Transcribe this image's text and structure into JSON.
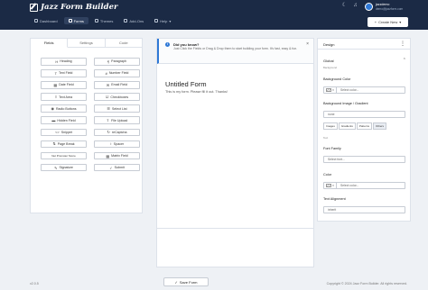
{
  "header": {
    "app_name": "Jazz Form Builder",
    "nav": [
      {
        "label": "Dashboard",
        "icon": "home-icon"
      },
      {
        "label": "Forms",
        "icon": "forms-icon"
      },
      {
        "label": "Themes",
        "icon": "themes-icon"
      },
      {
        "label": "Add-Ons",
        "icon": "addons-icon"
      },
      {
        "label": "Help",
        "icon": "help-icon"
      }
    ],
    "active_nav": "Forms",
    "user_name": "jazzdemo",
    "user_email": "demo@jazzform.com",
    "create_button": "Create New"
  },
  "left_panel": {
    "tabs": [
      "Fields",
      "Settings",
      "Code"
    ],
    "fields": [
      {
        "label": "Heading",
        "icon": "H"
      },
      {
        "label": "Paragraph",
        "icon": "¶"
      },
      {
        "label": "Text Field",
        "icon": "T"
      },
      {
        "label": "Number Field",
        "icon": "#"
      },
      {
        "label": "Date Field",
        "icon": "▦"
      },
      {
        "label": "Email Field",
        "icon": "✉"
      },
      {
        "label": "Text Area",
        "icon": "≡"
      },
      {
        "label": "Checkboxes",
        "icon": "☑"
      },
      {
        "label": "Radio Buttons",
        "icon": "◉"
      },
      {
        "label": "Select List",
        "icon": "☰"
      },
      {
        "label": "Hidden Field",
        "icon": "▬"
      },
      {
        "label": "File Upload",
        "icon": "⇪"
      },
      {
        "label": "Snippet",
        "icon": "<>"
      },
      {
        "label": "reCaptcha",
        "icon": "↻"
      },
      {
        "label": "Page Break",
        "icon": "⇅"
      },
      {
        "label": "Spacer",
        "icon": "↕"
      },
      {
        "label": "Net Promoter Score",
        "icon": ""
      },
      {
        "label": "Matrix Field",
        "icon": "▦"
      },
      {
        "label": "Signature",
        "icon": "✎"
      },
      {
        "label": "Submit",
        "icon": "✓"
      }
    ]
  },
  "center_panel": {
    "notice_title": "Did you know?",
    "notice_text": "Just Click the Fields or Drag & Drop them to start building your form. It's fast, easy & fun.",
    "form_title": "Untitled Form",
    "form_description": "This is my form. Please fill it out. Thanks!"
  },
  "design_panel": {
    "title": "Design",
    "section": "Global",
    "subsection": "Background",
    "bg_color_label": "Background Color",
    "bg_color_placeholder": "Select color...",
    "bg_image_label": "Background Image / Gradient",
    "bg_image_value": "none",
    "bg_type_options": [
      "Images",
      "Gradients",
      "Patterns",
      "Others"
    ],
    "text_section": "Text",
    "font_family_label": "Font Family",
    "font_family_placeholder": "Select font...",
    "color_label": "Color",
    "color_placeholder": "Select color...",
    "text_align_label": "Text Alignment",
    "text_align_value": "inherit"
  },
  "footer": {
    "version": "v2.0.5",
    "copyright": "Copyright © 2024 Jazz Form Builder. All rights reserved."
  },
  "save_button": "Save Form"
}
